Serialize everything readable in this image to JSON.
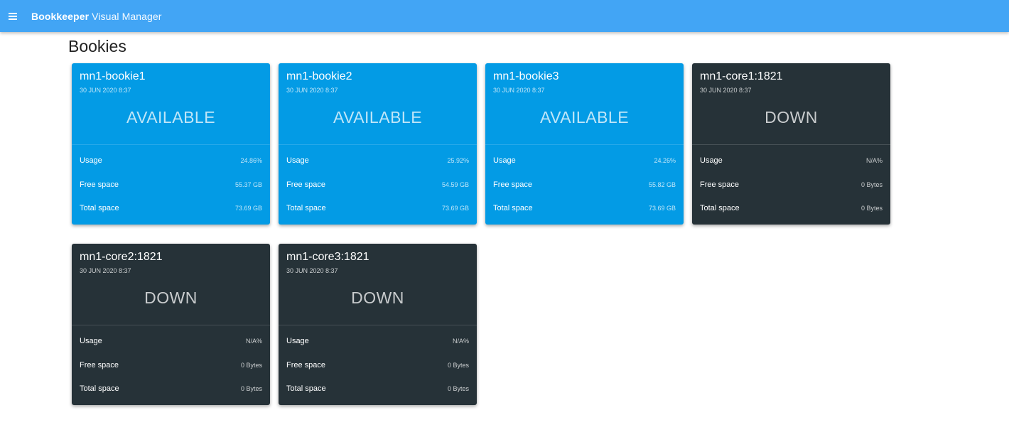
{
  "app": {
    "title_bold": "Bookkeeper",
    "title_rest": " Visual Manager"
  },
  "page": {
    "title": "Bookies"
  },
  "labels": {
    "usage": "Usage",
    "free_space": "Free space",
    "total_space": "Total space"
  },
  "colors": {
    "appbar": "#42a5f5",
    "available_card": "#039be5",
    "down_card": "#263238"
  },
  "bookies": [
    {
      "name": "mn1-bookie1",
      "date": "30 JUN 2020 8:37",
      "status": "AVAILABLE",
      "usage": "24.86%",
      "free": "55.37 GB",
      "total": "73.69 GB"
    },
    {
      "name": "mn1-bookie2",
      "date": "30 JUN 2020 8:37",
      "status": "AVAILABLE",
      "usage": "25.92%",
      "free": "54.59 GB",
      "total": "73.69 GB"
    },
    {
      "name": "mn1-bookie3",
      "date": "30 JUN 2020 8:37",
      "status": "AVAILABLE",
      "usage": "24.26%",
      "free": "55.82 GB",
      "total": "73.69 GB"
    },
    {
      "name": "mn1-core1:1821",
      "date": "30 JUN 2020 8:37",
      "status": "DOWN",
      "usage": "N/A%",
      "free": "0 Bytes",
      "total": "0 Bytes"
    },
    {
      "name": "mn1-core2:1821",
      "date": "30 JUN 2020 8:37",
      "status": "DOWN",
      "usage": "N/A%",
      "free": "0 Bytes",
      "total": "0 Bytes"
    },
    {
      "name": "mn1-core3:1821",
      "date": "30 JUN 2020 8:37",
      "status": "DOWN",
      "usage": "N/A%",
      "free": "0 Bytes",
      "total": "0 Bytes"
    }
  ]
}
